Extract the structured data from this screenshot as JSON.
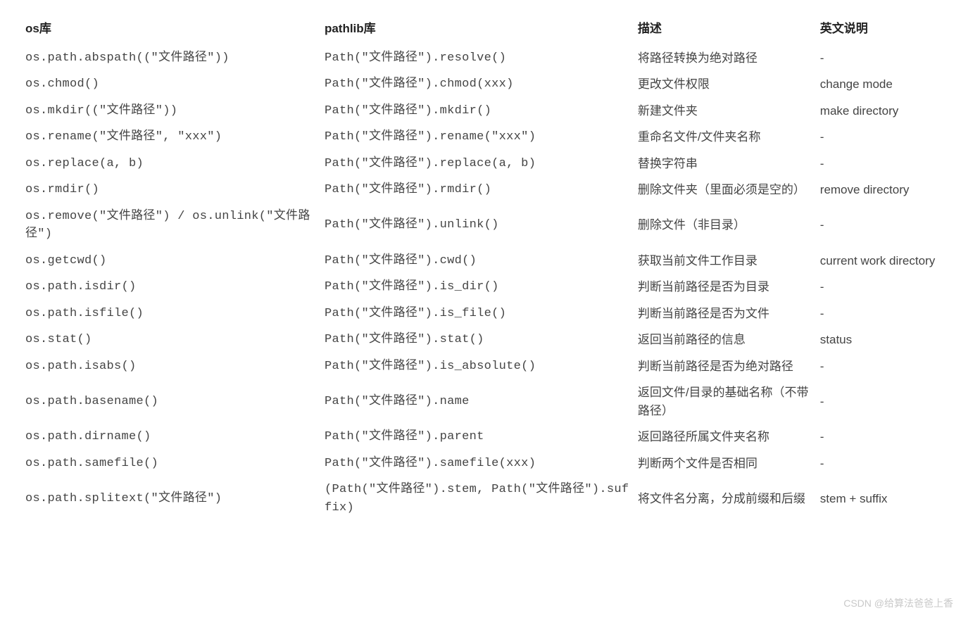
{
  "headers": {
    "col1": "os库",
    "col2": "pathlib库",
    "col3": "描述",
    "col4": "英文说明"
  },
  "rows": [
    {
      "os": "os.path.abspath((\"文件路径\"))",
      "pathlib": "Path(\"文件路径\").resolve()",
      "desc": "将路径转换为绝对路径",
      "eng": "-"
    },
    {
      "os": "os.chmod()",
      "pathlib": "Path(\"文件路径\").chmod(xxx)",
      "desc": "更改文件权限",
      "eng": "change mode"
    },
    {
      "os": "os.mkdir((\"文件路径\"))",
      "pathlib": "Path(\"文件路径\").mkdir()",
      "desc": "新建文件夹",
      "eng": "make directory"
    },
    {
      "os": "os.rename(\"文件路径\", \"xxx\")",
      "pathlib": "Path(\"文件路径\").rename(\"xxx\")",
      "desc": "重命名文件/文件夹名称",
      "eng": "-"
    },
    {
      "os": "os.replace(a, b)",
      "pathlib": "Path(\"文件路径\").replace(a, b)",
      "desc": "替换字符串",
      "eng": "-"
    },
    {
      "os": "os.rmdir()",
      "pathlib": "Path(\"文件路径\").rmdir()",
      "desc": "删除文件夹（里面必须是空的）",
      "eng": "remove directory"
    },
    {
      "os": "os.remove(\"文件路径\") / os.unlink(\"文件路径\")",
      "pathlib": "Path(\"文件路径\").unlink()",
      "desc": "删除文件（非目录）",
      "eng": "-"
    },
    {
      "os": "os.getcwd()",
      "pathlib": "Path(\"文件路径\").cwd()",
      "desc": "获取当前文件工作目录",
      "eng": "current work directory"
    },
    {
      "os": "os.path.isdir()",
      "pathlib": "Path(\"文件路径\").is_dir()",
      "desc": "判断当前路径是否为目录",
      "eng": "-"
    },
    {
      "os": "os.path.isfile()",
      "pathlib": "Path(\"文件路径\").is_file()",
      "desc": "判断当前路径是否为文件",
      "eng": "-"
    },
    {
      "os": "os.stat()",
      "pathlib": "Path(\"文件路径\").stat()",
      "desc": "返回当前路径的信息",
      "eng": "status"
    },
    {
      "os": "os.path.isabs()",
      "pathlib": "Path(\"文件路径\").is_absolute()",
      "desc": "判断当前路径是否为绝对路径",
      "eng": "-"
    },
    {
      "os": "os.path.basename()",
      "pathlib": "Path(\"文件路径\").name",
      "desc": "返回文件/目录的基础名称（不带路径）",
      "eng": "-"
    },
    {
      "os": "os.path.dirname()",
      "pathlib": "Path(\"文件路径\").parent",
      "desc": "返回路径所属文件夹名称",
      "eng": "-"
    },
    {
      "os": "os.path.samefile()",
      "pathlib": "Path(\"文件路径\").samefile(xxx)",
      "desc": "判断两个文件是否相同",
      "eng": "-"
    },
    {
      "os": "os.path.splitext(\"文件路径\")",
      "pathlib": "(Path(\"文件路径\").stem, Path(\"文件路径\").suffix)",
      "desc": "将文件名分离，分成前缀和后缀",
      "eng": "stem + suffix"
    }
  ],
  "watermark": "CSDN @给算法爸爸上香"
}
